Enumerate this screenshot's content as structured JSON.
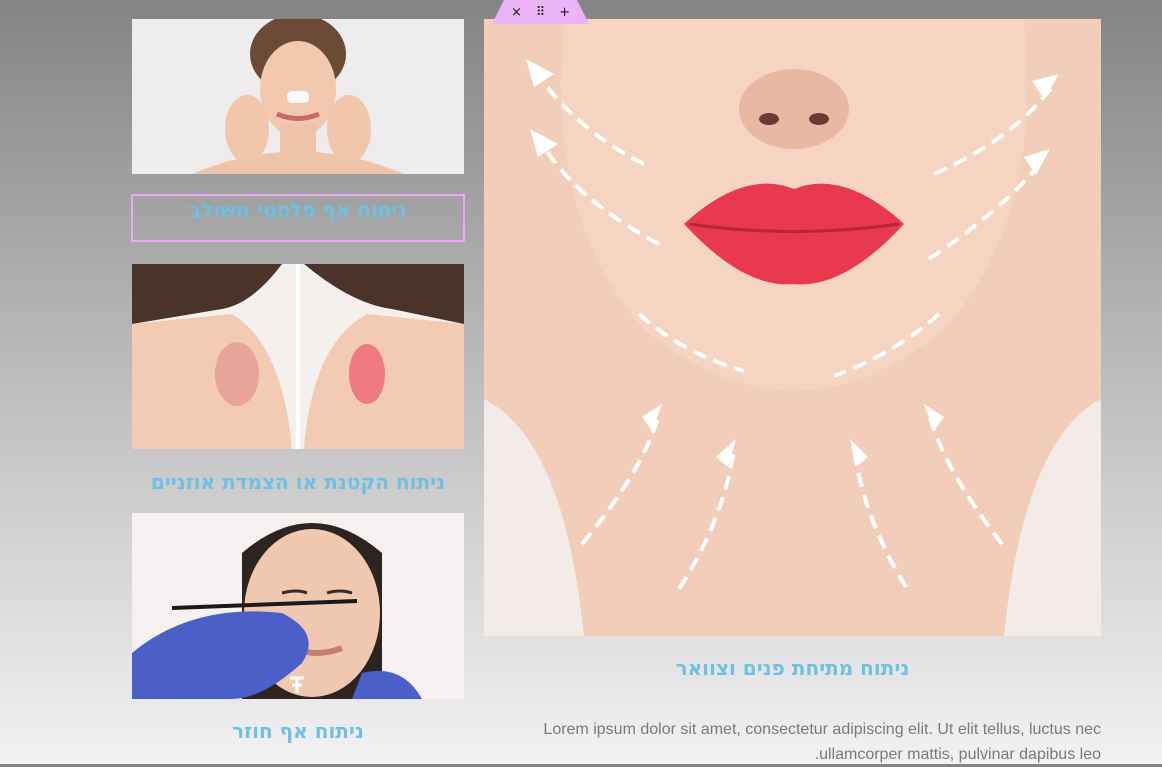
{
  "cards": [
    {
      "title": "ניתוח אף פלסטי משולב"
    },
    {
      "title": "ניתוח הקטנת או הצמדת אוזניים"
    },
    {
      "title": "ניתוח אף חוזר"
    }
  ],
  "main": {
    "title": "ניתוח מתיחת פנים וצוואר",
    "description": "Lorem ipsum dolor sit amet, consectetur adipiscing elit. Ut elit tellus, luctus nec ullamcorper mattis, pulvinar dapibus leo."
  },
  "toolbar": {
    "close_glyph": "×",
    "drag_glyph": "⠿",
    "add_glyph": "+",
    "accent": "#ebb4f6"
  },
  "colors": {
    "heading": "#6ec1e4",
    "body_text": "#7a7a7a",
    "selection_border": "#e9a9f5"
  }
}
